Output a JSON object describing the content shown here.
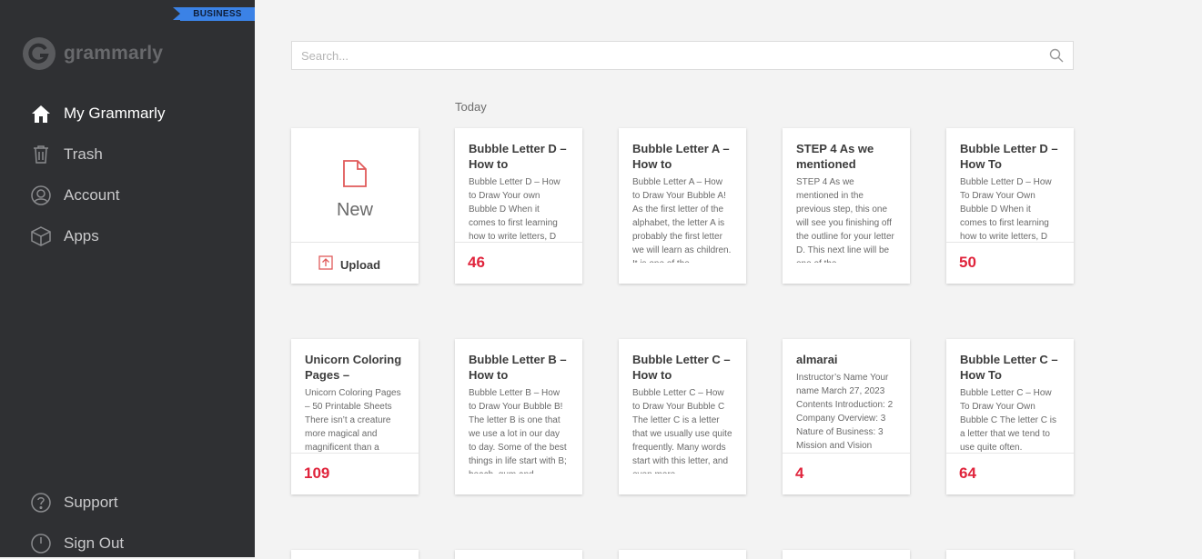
{
  "sidebar": {
    "badge": "BUSINESS",
    "logo_text": "grammarly",
    "nav": [
      {
        "label": "My Grammarly",
        "icon": "home-icon"
      },
      {
        "label": "Trash",
        "icon": "trash-icon"
      },
      {
        "label": "Account",
        "icon": "account-icon"
      },
      {
        "label": "Apps",
        "icon": "apps-icon"
      }
    ],
    "footer": [
      {
        "label": "Support",
        "icon": "question-icon"
      },
      {
        "label": "Sign Out",
        "icon": "power-icon"
      }
    ]
  },
  "search": {
    "placeholder": "Search..."
  },
  "section_label": "Today",
  "new_card": {
    "label": "New",
    "upload_label": "Upload"
  },
  "documents": [
    {
      "title": "Bubble Letter D – How to",
      "snippet": "Bubble Letter D – How to Draw Your own Bubble D When it comes to first learning how to write letters, D",
      "count": "46"
    },
    {
      "title": "Bubble Letter A – How to",
      "snippet": "Bubble Letter A – How to Draw Your Bubble A! As the first letter of the alphabet, the letter A is probably the first letter we will learn as children. It is one of the",
      "count": ""
    },
    {
      "title": "STEP 4 As we mentioned",
      "snippet": "STEP 4 As we mentioned in the previous step, this one will see you finishing off the outline for your letter D. This next line will be one of the",
      "count": ""
    },
    {
      "title": "Bubble Letter D – How To",
      "snippet": "Bubble Letter D – How To Draw Your Own Bubble D When it comes to first learning how to write letters, D",
      "count": "50"
    },
    {
      "title": "Unicorn Coloring Pages –",
      "snippet": "Unicorn Coloring Pages – 50 Printable Sheets There isn’t a creature more magical and magnificent than a",
      "count": "109"
    },
    {
      "title": "Bubble Letter B – How to",
      "snippet": "Bubble Letter B – How to Draw Your Bubble B! The letter B is one that we use a lot in our day to day. Some of the best things in life start with B; beach, gum and",
      "count": ""
    },
    {
      "title": "Bubble Letter C – How to",
      "snippet": "Bubble Letter C – How to Draw Your Bubble C The letter C is a letter that we usually use quite frequently. Many words start with this letter, and even more",
      "count": ""
    },
    {
      "title": "almarai",
      "snippet": "Instructor’s Name Your name March 27, 2023 Contents Introduction: 2 Company Overview: 3 Nature of Business: 3 Mission and Vision",
      "count": "4"
    },
    {
      "title": "Bubble Letter C – How To",
      "snippet": "Bubble Letter C – How To Draw Your Own Bubble C The letter C is a letter that we tend to use quite often.",
      "count": "64"
    }
  ],
  "colors": {
    "sidebar_bg": "#2f3033",
    "accent": "#e0243c",
    "badge": "#3b82e6"
  }
}
